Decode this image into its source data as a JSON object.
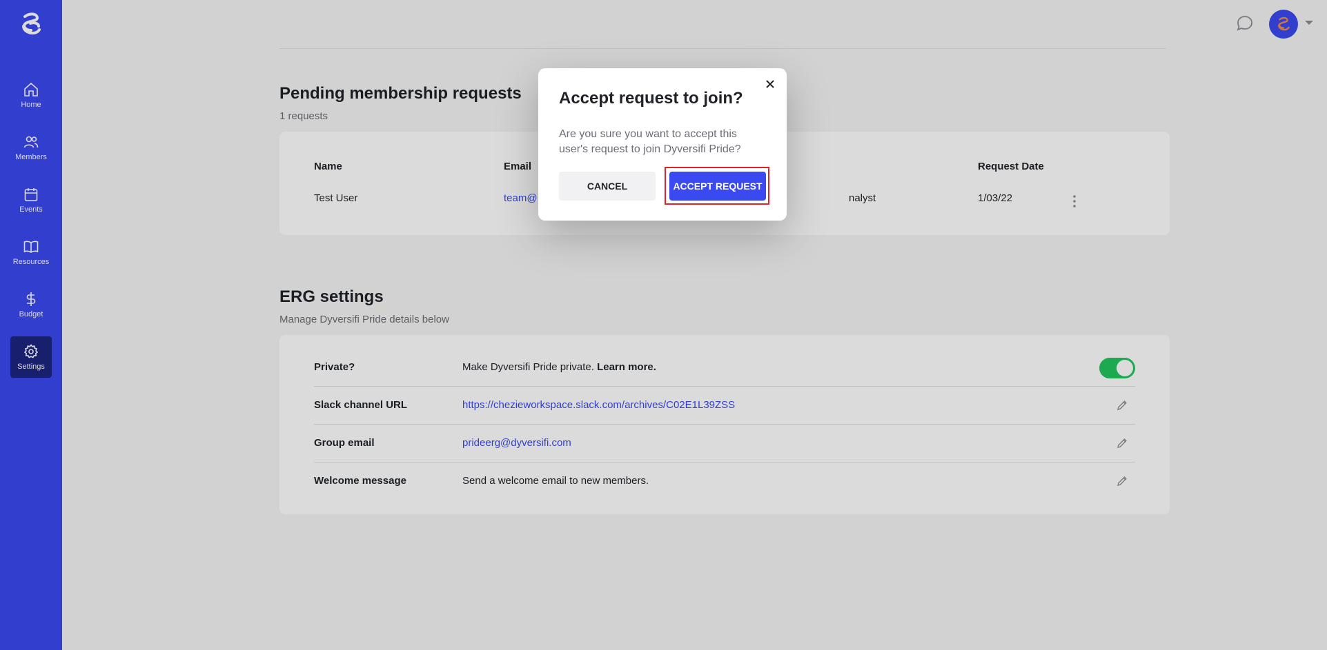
{
  "sidebar": {
    "items": [
      {
        "label": "Home"
      },
      {
        "label": "Members"
      },
      {
        "label": "Events"
      },
      {
        "label": "Resources"
      },
      {
        "label": "Budget"
      },
      {
        "label": "Settings"
      }
    ],
    "active": "Settings",
    "accent_color": "#3a49f0"
  },
  "pending": {
    "title": "Pending membership requests",
    "count_text": "1 requests",
    "columns": {
      "name": "Name",
      "email": "Email",
      "request_date": "Request Date"
    },
    "rows": [
      {
        "name": "Test User",
        "email": "team@",
        "role": "nalyst",
        "request_date": "1/03/22"
      }
    ]
  },
  "settings": {
    "title": "ERG settings",
    "subtitle": "Manage Dyversifi Pride details below",
    "private": {
      "label": "Private?",
      "text": "Make Dyversifi Pride private.",
      "link": "Learn more.",
      "enabled": true
    },
    "slack": {
      "label": "Slack channel URL",
      "value": "https://chezieworkspace.slack.com/archives/C02E1L39ZSS"
    },
    "email": {
      "label": "Group email",
      "value": "prideerg@dyversifi.com"
    },
    "welcome": {
      "label": "Welcome message",
      "value": "Send a welcome email to new members."
    }
  },
  "modal": {
    "title": "Accept request to join?",
    "body": "Are you sure you want to accept this user's request to join Dyversifi Pride?",
    "cancel_label": "CANCEL",
    "accept_label": "ACCEPT REQUEST",
    "highlight_color": "#e5202a"
  }
}
